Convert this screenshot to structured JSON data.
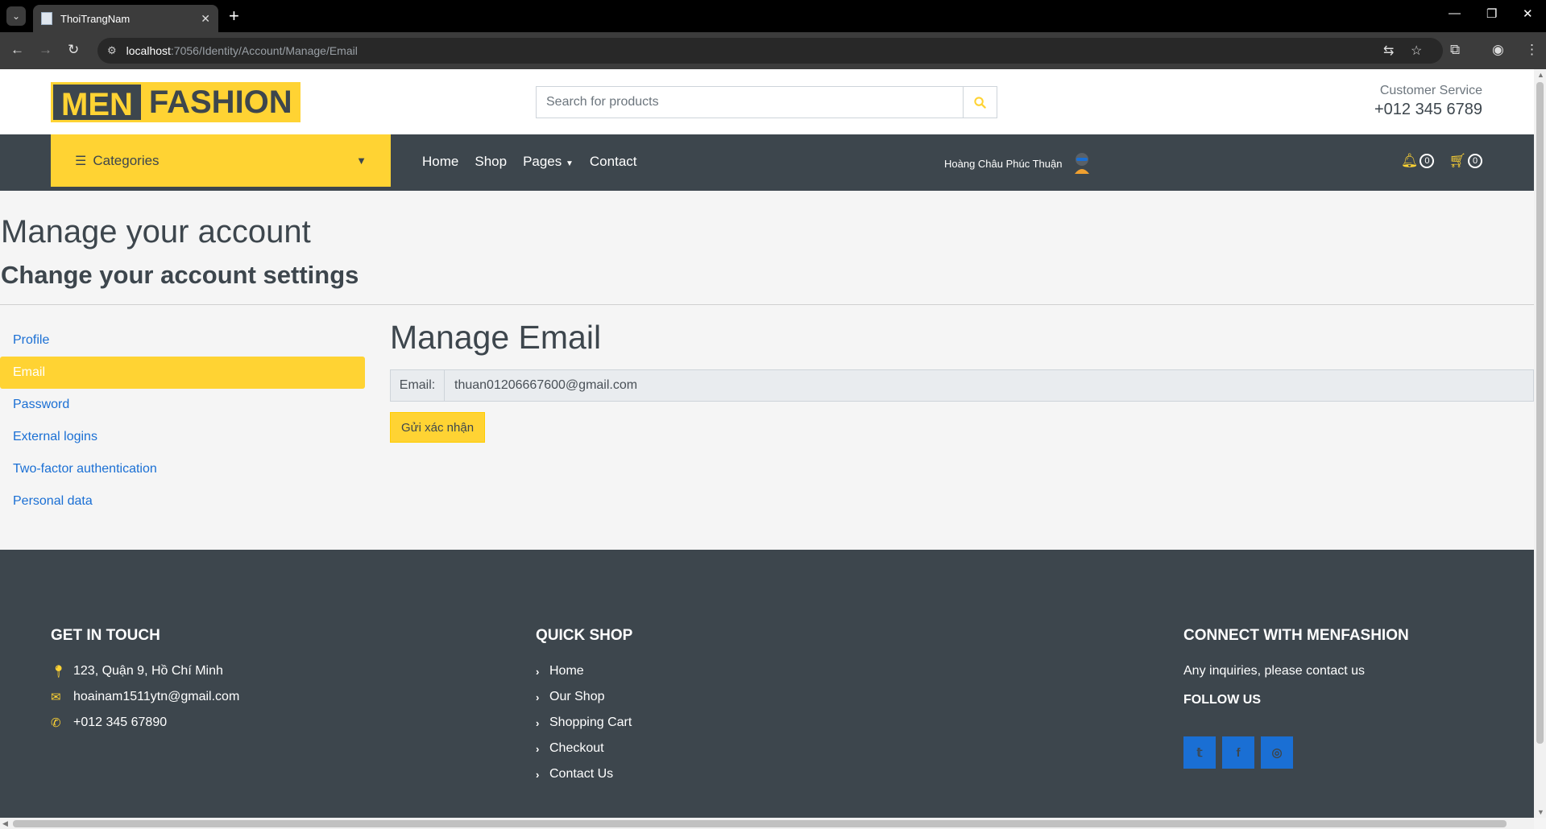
{
  "browser": {
    "tab_title": "ThoiTrangNam",
    "url_host": "localhost",
    "url_rest": ":7056/Identity/Account/Manage/Email"
  },
  "header": {
    "logo_part1": "MEN",
    "logo_part2": "FASHION",
    "search_placeholder": "Search for products",
    "customer_service_label": "Customer Service",
    "customer_service_phone": "+012 345 6789"
  },
  "nav": {
    "categories_label": "Categories",
    "menu": [
      "Home",
      "Shop",
      "Pages",
      "Contact"
    ],
    "user_name": "Hoàng Châu Phúc Thuận",
    "notification_count": "0",
    "cart_count": "0"
  },
  "page": {
    "title": "Manage your account",
    "subtitle": "Change your account settings",
    "side_menu": [
      "Profile",
      "Email",
      "Password",
      "External logins",
      "Two-factor authentication",
      "Personal data"
    ],
    "active_item": "Email",
    "section_heading": "Manage Email",
    "email_label": "Email:",
    "email_value": "thuan01206667600@gmail.com",
    "confirm_button": "Gửi xác nhận"
  },
  "footer": {
    "get_in_touch": {
      "heading": "GET IN TOUCH",
      "address": "123, Quận 9, Hồ Chí Minh",
      "email": "hoainam1511ytn@gmail.com",
      "phone": "+012 345 67890"
    },
    "quick_shop": {
      "heading": "QUICK SHOP",
      "links": [
        "Home",
        "Our Shop",
        "Shopping Cart",
        "Checkout",
        "Contact Us"
      ]
    },
    "connect": {
      "heading": "CONNECT WITH MENFASHION",
      "text": "Any inquiries, please contact us",
      "follow_heading": "FOLLOW US",
      "social": [
        "twitter-icon",
        "facebook-icon",
        "instagram-icon"
      ]
    }
  },
  "colors": {
    "accent": "#ffd333",
    "dark": "#3d464d",
    "link": "#1a6fd4"
  }
}
